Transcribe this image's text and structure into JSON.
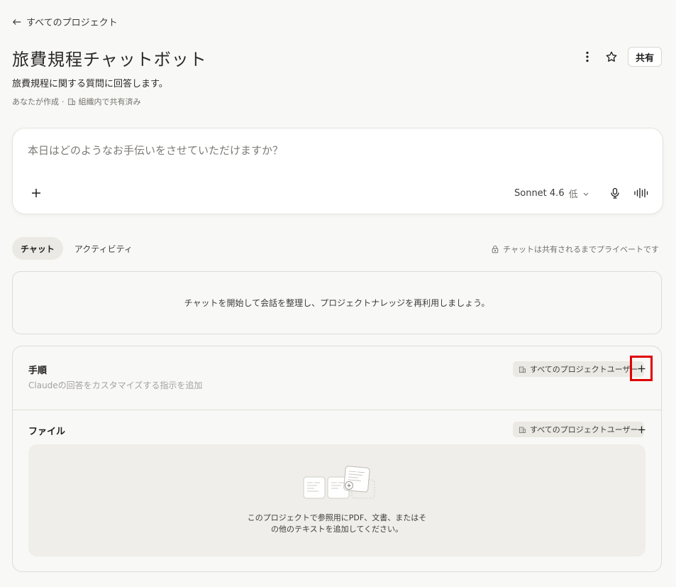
{
  "nav": {
    "back_label": "すべてのプロジェクト"
  },
  "project": {
    "title": "旅費規程チャットボット",
    "description": "旅費規程に関する質問に回答します。",
    "creator": "あなたが作成",
    "separator": "·",
    "sharing_status": "組織内で共有済み",
    "share_label": "共有"
  },
  "composer": {
    "placeholder": "本日はどのようなお手伝いをさせていただけますか？",
    "model": "Sonnet 4.6",
    "effort": "低"
  },
  "tabs": [
    {
      "label": "チャット",
      "active": true
    },
    {
      "label": "アクティビティ",
      "active": false
    }
  ],
  "privacy_note": "チャットは共有されるまでプライベートです",
  "empty_chat_message": "チャットを開始して会話を整理し、プロジェクトナレッジを再利用しましょう。",
  "instructions": {
    "title": "手順",
    "subtitle": "Claudeの回答をカスタマイズする指示を追加",
    "scope": "すべてのプロジェクトユーザー"
  },
  "files": {
    "title": "ファイル",
    "scope": "すべてのプロジェクトユーザー",
    "empty_line1": "このプロジェクトで参照用にPDF、文書、またはそ",
    "empty_line2": "の他のテキストを追加してください。"
  },
  "colors": {
    "background": "#f8f8f6",
    "highlight": "#e00000",
    "badge_bg": "#ebe9e3"
  }
}
